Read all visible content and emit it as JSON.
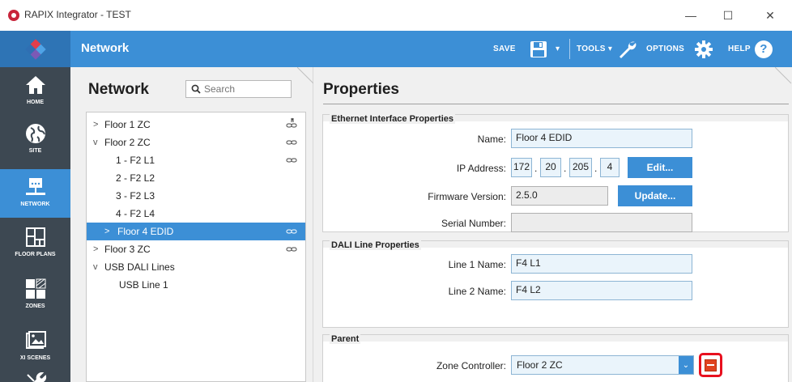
{
  "window": {
    "title": "RAPIX Integrator - TEST",
    "minimize_glyph": "—",
    "maximize_glyph": "☐",
    "close_glyph": "✕"
  },
  "toolbar": {
    "section_title": "Network",
    "save_label": "SAVE",
    "tools_label": "TOOLS ▾",
    "options_label": "OPTIONS",
    "help_label": "HELP",
    "dropdown_glyph": "▾",
    "help_glyph": "?"
  },
  "leftnav": {
    "items": [
      {
        "label": "HOME",
        "icon": "home-icon"
      },
      {
        "label": "SITE",
        "icon": "globe-icon"
      },
      {
        "label": "NETWORK",
        "icon": "network-icon",
        "active": true
      },
      {
        "label": "FLOOR PLANS",
        "icon": "floor-plans-icon"
      },
      {
        "label": "ZONES",
        "icon": "zones-icon"
      },
      {
        "label": "XI SCENES",
        "icon": "scenes-icon"
      }
    ]
  },
  "network_panel": {
    "heading": "Network",
    "search_placeholder": "Search",
    "tree": [
      {
        "label": "Floor 1 ZC",
        "chevron": ">",
        "indent": 0,
        "link": true
      },
      {
        "label": "Floor 2 ZC",
        "chevron": "v",
        "indent": 0,
        "link": true
      },
      {
        "label": "1 - F2 L1",
        "chevron": "",
        "indent": 1,
        "link": true
      },
      {
        "label": "2 - F2 L2",
        "chevron": "",
        "indent": 1,
        "link": false
      },
      {
        "label": "3 - F2 L3",
        "chevron": "",
        "indent": 1,
        "link": false
      },
      {
        "label": "4 - F2 L4",
        "chevron": "",
        "indent": 1,
        "link": false
      },
      {
        "label": "Floor 4 EDID",
        "chevron": ">",
        "indent": 1,
        "link": true,
        "selected": true
      },
      {
        "label": "Floor 3 ZC",
        "chevron": ">",
        "indent": 0,
        "link": true
      },
      {
        "label": "USB DALI Lines",
        "chevron": "v",
        "indent": 0,
        "link": false
      },
      {
        "label": "USB Line 1",
        "chevron": "",
        "indent": 1,
        "link": false
      }
    ]
  },
  "properties": {
    "heading": "Properties",
    "ethernet": {
      "title": "Ethernet Interface Properties",
      "name_label": "Name:",
      "name_value": "Floor 4 EDID",
      "ip_label": "IP Address:",
      "ip": [
        "172",
        "20",
        "205",
        "4"
      ],
      "ip_dot": ".",
      "edit_label": "Edit...",
      "firmware_label": "Firmware Version:",
      "firmware_value": "2.5.0",
      "update_label": "Update...",
      "serial_label": "Serial Number:",
      "serial_value": ""
    },
    "dali": {
      "title": "DALI Line Properties",
      "line1_label": "Line 1 Name:",
      "line1_value": "F4 L1",
      "line2_label": "Line 2 Name:",
      "line2_value": "F4 L2"
    },
    "parent": {
      "title": "Parent",
      "zc_label": "Zone Controller:",
      "zc_value": "Floor 2 ZC",
      "select_arrow": "⌄"
    }
  },
  "colors": {
    "accent": "#3c8fd6",
    "nav_bg": "#3d4852",
    "highlight_red": "#e8101e"
  }
}
